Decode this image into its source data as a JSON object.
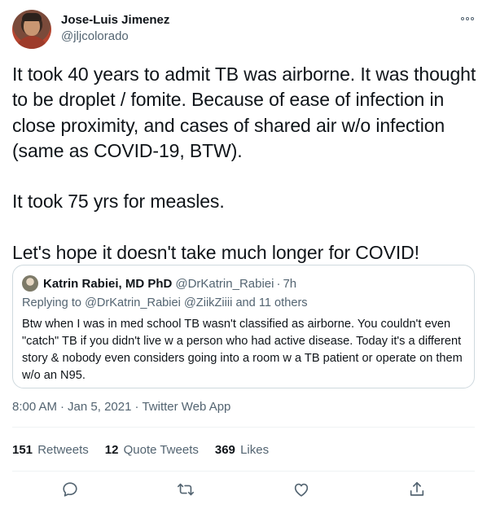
{
  "author": {
    "name": "Jose-Luis Jimenez",
    "handle": "@jljcolorado",
    "avatar_icon": "profile-photo"
  },
  "tweet": {
    "text": "It took 40 years to admit TB was airborne. It was thought to be droplet / fomite. Because of ease of infection in close proximity, and cases of shared air w/o infection (same as COVID-19, BTW).\n\nIt took 75 yrs for measles.\n\nLet's hope it doesn't take much longer for COVID!"
  },
  "quoted": {
    "name": "Katrin Rabiei, MD PhD",
    "handle": "@DrKatrin_Rabiei",
    "separator": "·",
    "time": "7h",
    "reply_prefix": "Replying to",
    "reply_to_1": "@DrKatrin_Rabiei",
    "reply_to_2": "@ZiikZiiii",
    "reply_suffix": "and 11 others",
    "text": "Btw when I was in med school TB wasn't classified as airborne. You couldn't even \"catch\" TB if you didn't live w a person who had active disease. Today it's a different story & nobody even considers going into a room w a TB patient or operate on them w/o an N95."
  },
  "meta": {
    "time": "8:00 AM",
    "separator": "·",
    "date": "Jan 5, 2021",
    "app": "Twitter Web App"
  },
  "stats": {
    "retweets_count": "151",
    "retweets_label": "Retweets",
    "quotes_count": "12",
    "quotes_label": "Quote Tweets",
    "likes_count": "369",
    "likes_label": "Likes"
  },
  "colors": {
    "text": "#0f1419",
    "secondary": "#536471",
    "border": "#cfd9de"
  },
  "icons": {
    "reply": "reply-icon",
    "retweet": "retweet-icon",
    "like": "like-icon",
    "share": "share-icon",
    "more": "more-icon"
  }
}
